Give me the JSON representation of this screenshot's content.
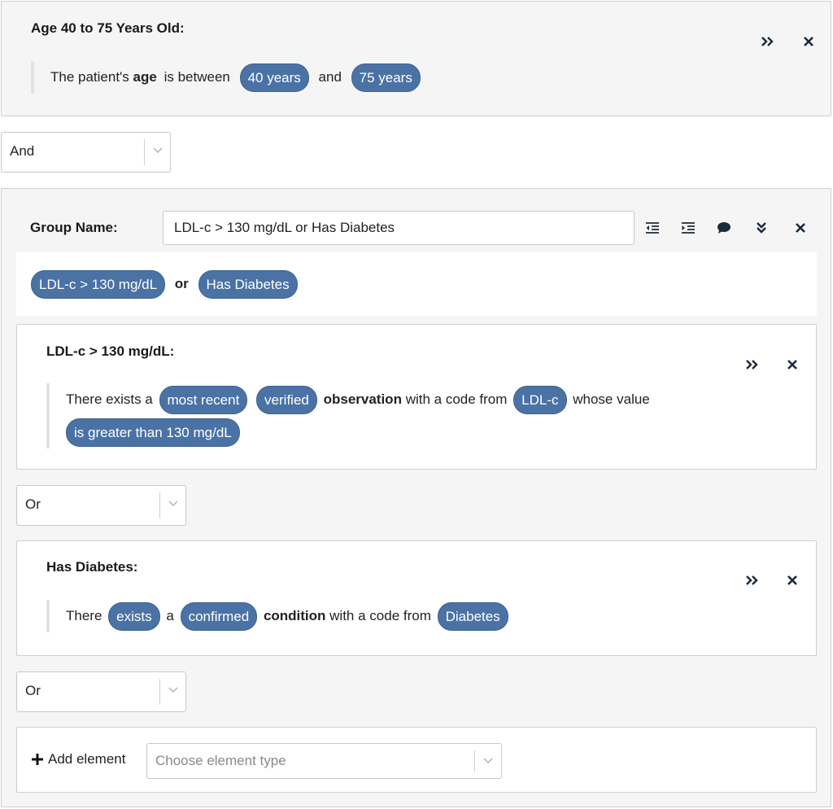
{
  "age_element": {
    "title": "Age 40 to 75 Years Old:",
    "desc": {
      "prefix": "The patient's",
      "bold": "age",
      "mid": "is between",
      "pill_min": "40 years",
      "conj": "and",
      "pill_max": "75 years"
    }
  },
  "top_conjunction": {
    "value": "And"
  },
  "group": {
    "name_label": "Group Name:",
    "name_value": "LDL-c > 130 mg/dL or Has Diabetes",
    "summary": {
      "pill_a": "LDL-c > 130 mg/dL",
      "op": "or",
      "pill_b": "Has Diabetes"
    },
    "ldl": {
      "title": "LDL-c > 130 mg/dL:",
      "desc": {
        "t1": "There exists a",
        "pill_recent": "most recent",
        "pill_verified": "verified",
        "bold": "observation",
        "t2": "with a code from",
        "pill_code": "LDL-c",
        "t3": "whose value",
        "pill_value": "is greater than 130 mg/dL"
      }
    },
    "conj1": {
      "value": "Or"
    },
    "diabetes": {
      "title": "Has Diabetes:",
      "desc": {
        "t1": "There",
        "pill_exists": "exists",
        "t2": "a",
        "pill_confirmed": "confirmed",
        "bold": "condition",
        "t3": "with a code from",
        "pill_code": "Diabetes"
      }
    },
    "conj2": {
      "value": "Or"
    },
    "add": {
      "label": "Add element",
      "placeholder": "Choose element type"
    }
  }
}
